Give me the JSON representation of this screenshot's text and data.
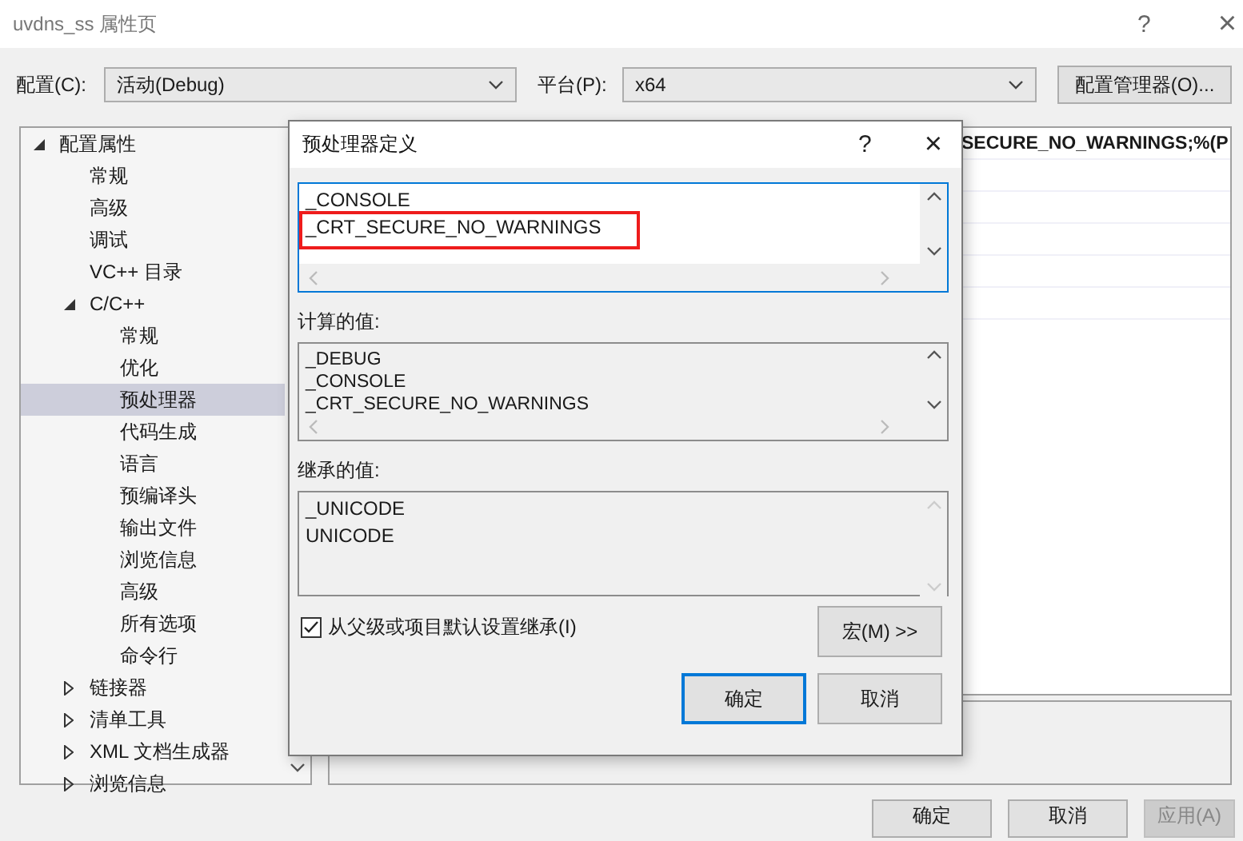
{
  "window": {
    "title": "uvdns_ss 属性页",
    "help": "?",
    "close": "×"
  },
  "config_row": {
    "config_label": "配置(C):",
    "config_value": "活动(Debug)",
    "platform_label": "平台(P):",
    "platform_value": "x64",
    "manager_button": "配置管理器(O)..."
  },
  "tree": [
    {
      "label": "配置属性",
      "expanded": true,
      "selected": false,
      "children": [
        {
          "label": "常规",
          "selected": false
        },
        {
          "label": "高级",
          "selected": false
        },
        {
          "label": "调试",
          "selected": false
        },
        {
          "label": "VC++ 目录",
          "selected": false
        },
        {
          "label": "C/C++",
          "expanded": true,
          "selected": false,
          "children": [
            {
              "label": "常规",
              "selected": false
            },
            {
              "label": "优化",
              "selected": false
            },
            {
              "label": "预处理器",
              "selected": true
            },
            {
              "label": "代码生成",
              "selected": false
            },
            {
              "label": "语言",
              "selected": false
            },
            {
              "label": "预编译头",
              "selected": false
            },
            {
              "label": "输出文件",
              "selected": false
            },
            {
              "label": "浏览信息",
              "selected": false
            },
            {
              "label": "高级",
              "selected": false
            },
            {
              "label": "所有选项",
              "selected": false
            },
            {
              "label": "命令行",
              "selected": false
            }
          ]
        },
        {
          "label": "链接器",
          "expanded": false,
          "selected": false
        },
        {
          "label": "清单工具",
          "expanded": false,
          "selected": false
        },
        {
          "label": "XML 文档生成器",
          "expanded": false,
          "selected": false
        },
        {
          "label": "浏览信息",
          "expanded": false,
          "selected": false
        }
      ]
    }
  ],
  "property_grid": {
    "first_row_value": "SECURE_NO_WARNINGS;%(P"
  },
  "footer_buttons": [
    {
      "label": "确定",
      "disabled": false
    },
    {
      "label": "取消",
      "disabled": false
    },
    {
      "label": "应用(A)",
      "disabled": true
    }
  ],
  "dialog": {
    "title": "预处理器定义",
    "help": "?",
    "close": "×",
    "definitions": [
      {
        "text": "_CONSOLE",
        "highlighted": false
      },
      {
        "text": "_CRT_SECURE_NO_WARNINGS",
        "highlighted": true
      }
    ],
    "evaluated_label": "计算的值:",
    "evaluated": [
      "_DEBUG",
      "_CONSOLE",
      "_CRT_SECURE_NO_WARNINGS"
    ],
    "inherited_label": "继承的值:",
    "inherited": [
      "_UNICODE",
      "UNICODE"
    ],
    "inherit_checkbox": {
      "label": "从父级或项目默认设置继承(I)",
      "checked": true
    },
    "macros_button": "宏(M) >>",
    "buttons": [
      {
        "label": "确定",
        "default": true
      },
      {
        "label": "取消",
        "default": false
      }
    ]
  }
}
